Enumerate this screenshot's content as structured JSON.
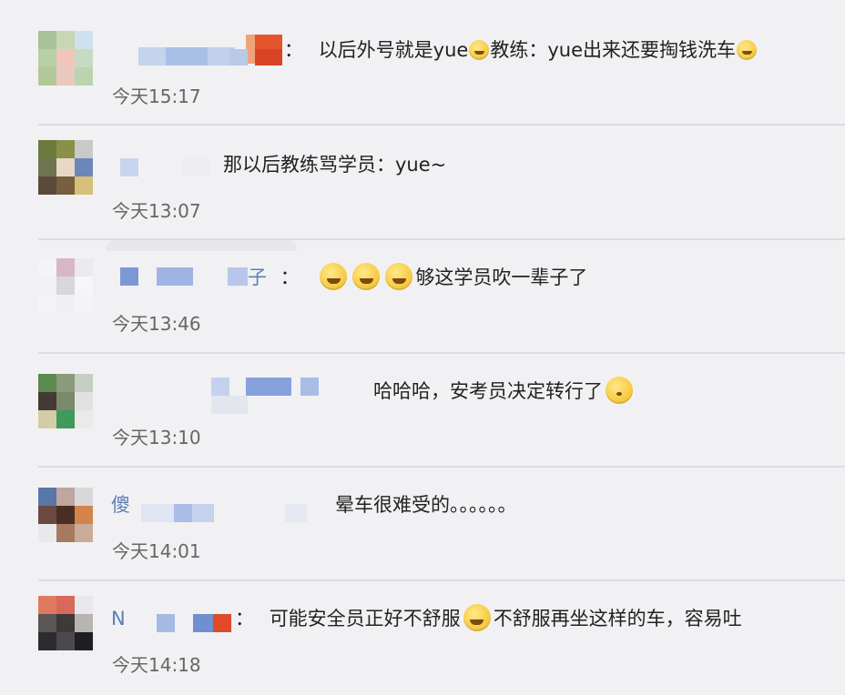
{
  "comments": [
    {
      "name_visible": "",
      "separator": "：",
      "content": "以后外号就是yue",
      "content_mid": "教练：yue出来还要掏钱洗车",
      "emoji_1": "hug-emoji",
      "emoji_2": "hug-emoji",
      "time": "今天15:17"
    },
    {
      "name_visible": "",
      "separator": "",
      "content": "那以后教练骂学员：yue~",
      "time": "今天13:07"
    },
    {
      "name_visible": "子",
      "separator": "：",
      "content": "够这学员吹一辈子了",
      "emojis": [
        "laugh-cry-emoji",
        "laugh-cry-emoji",
        "laugh-cry-emoji"
      ],
      "time": "今天13:46"
    },
    {
      "name_visible": "",
      "separator": "",
      "content": "哈哈哈，安考员决定转行了",
      "emoji": "hush-emoji",
      "time": "今天13:10"
    },
    {
      "name_visible": "傻",
      "separator": "",
      "content": "晕车很难受的。。。。。。",
      "time": "今天14:01"
    },
    {
      "name_visible": "N",
      "separator": "：",
      "content": "可能安全员正好不舒服",
      "content_after": "不舒服再坐这样的车，容易吐",
      "emoji": "laugh-cry-emoji",
      "time": "今天14:18"
    }
  ]
}
